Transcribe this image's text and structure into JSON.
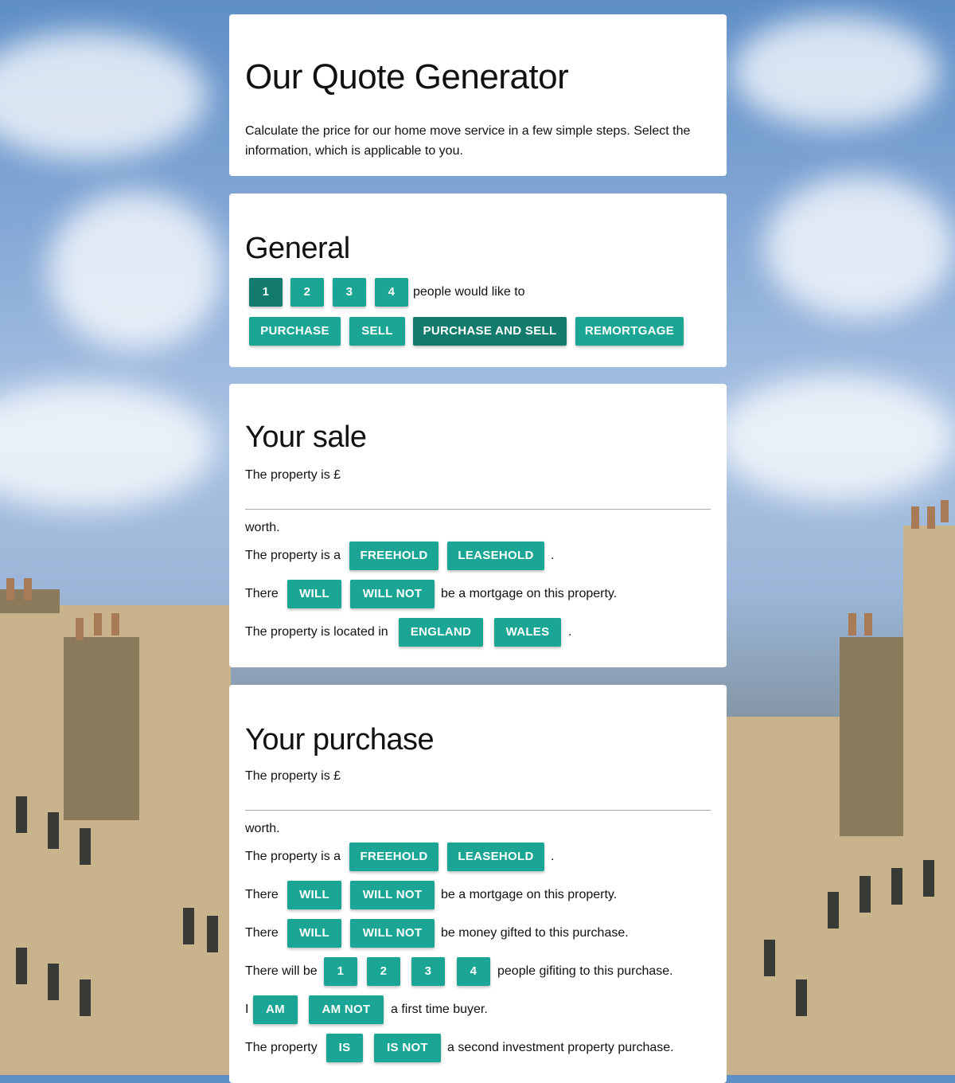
{
  "header": {
    "title": "Our Quote Generator",
    "intro_line1": "Calculate the price for our home move service in a few simple steps. Select the",
    "intro_line2": "information, which is applicable to you."
  },
  "general": {
    "heading": "General",
    "people_options": [
      "1",
      "2",
      "3",
      "4"
    ],
    "people_selected": "1",
    "people_suffix": "people would like to",
    "actions": [
      "PURCHASE",
      "SELL",
      "PURCHASE AND SELL",
      "REMORTGAGE"
    ],
    "action_selected": "PURCHASE AND SELL"
  },
  "sale": {
    "heading": "Your sale",
    "price_prefix": "The property is £",
    "price_value": "",
    "price_suffix": "worth.",
    "tenure_prefix": "The property is a",
    "tenure_options": [
      "FREEHOLD",
      "LEASEHOLD"
    ],
    "tenure_suffix": ".",
    "mortgage_prefix": "There",
    "mortgage_options": [
      "WILL",
      "WILL NOT"
    ],
    "mortgage_suffix": "be a mortgage on this property.",
    "location_prefix": "The property is located in",
    "location_options": [
      "ENGLAND",
      "WALES"
    ],
    "location_suffix": "."
  },
  "purchase": {
    "heading": "Your purchase",
    "price_prefix": "The property is £",
    "price_value": "",
    "price_suffix": "worth.",
    "tenure_prefix": "The property is a",
    "tenure_options": [
      "FREEHOLD",
      "LEASEHOLD"
    ],
    "tenure_suffix": ".",
    "mortgage_prefix": "There",
    "mortgage_options": [
      "WILL",
      "WILL NOT"
    ],
    "mortgage_suffix": "be a mortgage on this property.",
    "gift_prefix": "There",
    "gift_options": [
      "WILL",
      "WILL NOT"
    ],
    "gift_suffix": "be money gifted to this purchase.",
    "gifters_prefix": "There will be",
    "gifters_options": [
      "1",
      "2",
      "3",
      "4"
    ],
    "gifters_suffix": "people gifiting to this purchase.",
    "ftb_prefix": "I",
    "ftb_options": [
      "AM",
      "AM NOT"
    ],
    "ftb_suffix": "a first time buyer.",
    "invest_prefix": "The property",
    "invest_options": [
      "IS",
      "IS NOT"
    ],
    "invest_suffix": "a second investment property purchase."
  },
  "colors": {
    "accent": "#1aa595",
    "accent_selected": "#137a6e",
    "card_bg": "#ffffff"
  }
}
